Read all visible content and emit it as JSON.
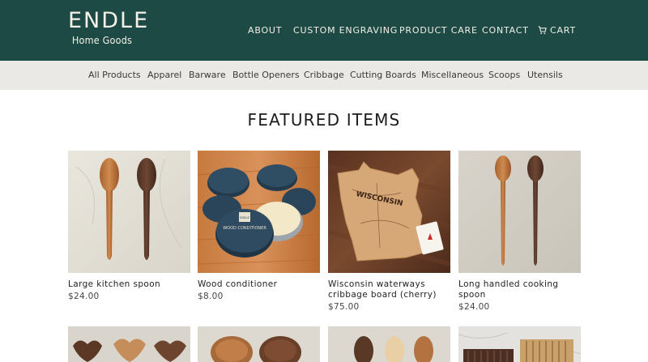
{
  "brand": {
    "name": "ENDLE",
    "tagline": "Home Goods"
  },
  "topnav": [
    "ABOUT",
    "CUSTOM ENGRAVING",
    "PRODUCT CARE",
    "CONTACT",
    "CART"
  ],
  "categories": [
    "All Products",
    "Apparel",
    "Barware",
    "Bottle Openers",
    "Cribbage",
    "Cutting Boards",
    "Miscellaneous",
    "Scoops",
    "Utensils"
  ],
  "section_title": "FEATURED ITEMS",
  "products": [
    {
      "name": "Large kitchen spoon",
      "price": "$24.00"
    },
    {
      "name": "Wood conditioner",
      "price": "$8.00",
      "tin_label": "WOOD CONDITIONER",
      "tin_brand": "ENDLE"
    },
    {
      "name": "Wisconsin waterways cribbage board (cherry)",
      "price": "$75.00",
      "board_text": "WISCONSIN"
    },
    {
      "name": "Long handled cooking spoon",
      "price": "$24.00"
    }
  ],
  "colors": {
    "header_bg": "#1e4a45",
    "category_bg": "#ebe9e5",
    "header_text": "#f1efe6"
  },
  "icons": {
    "cart": "cart-icon"
  }
}
